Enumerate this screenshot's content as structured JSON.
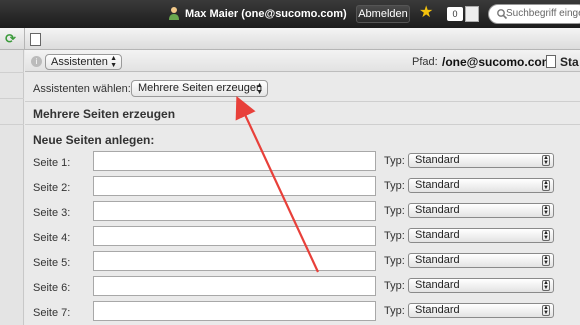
{
  "topbar": {
    "user": "Max Maier (one@sucomo.com)",
    "logout": "Abmelden",
    "notifications": "0",
    "search_placeholder": "Suchbegriff einge"
  },
  "header": {
    "assistant_select": "Assistenten",
    "path_label": "Pfad:",
    "path_value": "/one@sucomo.com/",
    "path_tail": "Sta"
  },
  "main": {
    "choose_label": "Assistenten wählen:",
    "wizard_selected": "Mehrere Seiten erzeugen",
    "section_title": "Mehrere Seiten erzeugen",
    "subsection_title": "Neue Seiten anlegen:",
    "typ_label": "Typ:",
    "rows": [
      {
        "label": "Seite 1:",
        "value": "",
        "type": "Standard"
      },
      {
        "label": "Seite 2:",
        "value": "",
        "type": "Standard"
      },
      {
        "label": "Seite 3:",
        "value": "",
        "type": "Standard"
      },
      {
        "label": "Seite 4:",
        "value": "",
        "type": "Standard"
      },
      {
        "label": "Seite 5:",
        "value": "",
        "type": "Standard"
      },
      {
        "label": "Seite 6:",
        "value": "",
        "type": "Standard"
      },
      {
        "label": "Seite 7:",
        "value": "",
        "type": "Standard"
      }
    ]
  },
  "icons": {
    "user": "user-icon",
    "favorite": "star-icon",
    "edit": "edit-icon",
    "search": "search-icon",
    "refresh": "refresh-icon",
    "page": "page-icon",
    "info": "info-icon"
  },
  "colors": {
    "topbar": "#2a2a2a",
    "star": "#f4c20d",
    "annotation_arrow": "#e8403a"
  }
}
